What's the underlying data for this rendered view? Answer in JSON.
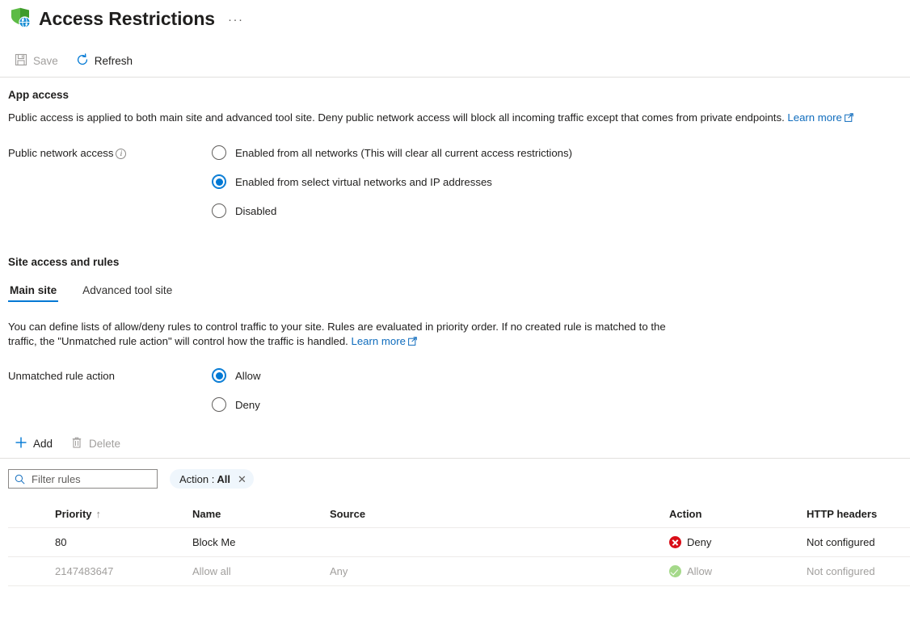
{
  "header": {
    "title": "Access Restrictions",
    "more_label": "···",
    "icon": "shield-globe-icon"
  },
  "commandbar": {
    "save_label": "Save",
    "save_icon": "save-disk-icon",
    "save_disabled": true,
    "refresh_label": "Refresh",
    "refresh_icon": "refresh-icon"
  },
  "app_access": {
    "section_title": "App access",
    "description": "Public access is applied to both main site and advanced tool site. Deny public network access will block all incoming traffic except that comes from private endpoints.",
    "learn_more": "Learn more",
    "field_label": "Public network access",
    "info_icon": "info-icon",
    "options": [
      {
        "label": "Enabled from all networks (This will clear all current access restrictions)",
        "selected": false
      },
      {
        "label": "Enabled from select virtual networks and IP addresses",
        "selected": true
      },
      {
        "label": "Disabled",
        "selected": false
      }
    ]
  },
  "site_access": {
    "section_title": "Site access and rules",
    "tabs": [
      {
        "label": "Main site",
        "active": true
      },
      {
        "label": "Advanced tool site",
        "active": false
      }
    ],
    "description": "You can define lists of allow/deny rules to control traffic to your site. Rules are evaluated in priority order. If no created rule is matched to the traffic, the \"Unmatched rule action\" will control how the traffic is handled.",
    "learn_more": "Learn more",
    "unmatched_label": "Unmatched rule action",
    "unmatched_options": [
      {
        "label": "Allow",
        "selected": true
      },
      {
        "label": "Deny",
        "selected": false
      }
    ]
  },
  "list_commands": {
    "add_label": "Add",
    "add_icon": "plus-icon",
    "delete_label": "Delete",
    "delete_icon": "trash-icon",
    "delete_disabled": true
  },
  "filters": {
    "search_placeholder": "Filter rules",
    "search_value": "",
    "search_icon": "search-icon",
    "pill_label": "Action :",
    "pill_value": "All",
    "pill_clear_icon": "close-icon"
  },
  "table": {
    "columns": [
      {
        "label": "Priority",
        "sort": "↑"
      },
      {
        "label": "Name",
        "sort": ""
      },
      {
        "label": "Source",
        "sort": ""
      },
      {
        "label": "Action",
        "sort": ""
      },
      {
        "label": "HTTP headers",
        "sort": ""
      }
    ],
    "rows": [
      {
        "priority": "80",
        "name": "Block Me",
        "source": "",
        "action": "Deny",
        "action_icon": "deny-icon",
        "http_headers": "Not configured",
        "dimmed": false
      },
      {
        "priority": "2147483647",
        "name": "Allow all",
        "source": "Any",
        "action": "Allow",
        "action_icon": "allow-icon",
        "http_headers": "Not configured",
        "dimmed": true
      }
    ]
  },
  "colors": {
    "accent": "#0078d4",
    "link": "#0f6cbd",
    "deny": "#d90d17",
    "allow": "#a5d98a",
    "pill_bg": "#eff6fc"
  }
}
